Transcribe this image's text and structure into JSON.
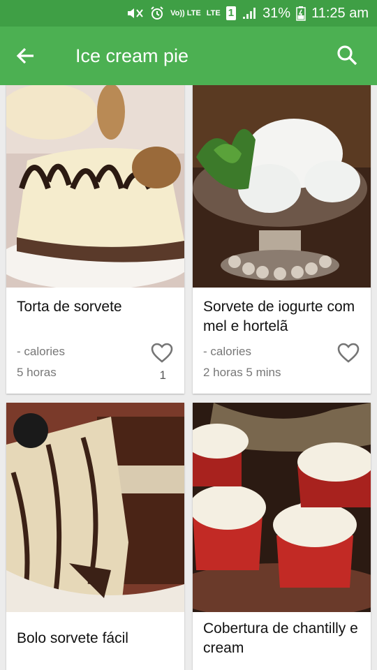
{
  "status_bar": {
    "volte_label": "Vo)) LTE",
    "lte_label": "LTE",
    "sim_number": "1",
    "battery": "31%",
    "time": "11:25 am"
  },
  "app_bar": {
    "title": "Ice cream pie",
    "back_icon": "arrow-back-icon",
    "search_icon": "search-icon",
    "background_color": "#4cb052",
    "status_color": "#3f9f45"
  },
  "recipes": [
    {
      "title": "Torta de sorvete",
      "calories": "- calories",
      "time": "5 horas",
      "likes": "1"
    },
    {
      "title": "Sorvete de iogurte com mel e hortelã",
      "calories": "- calories",
      "time": "2 horas 5 mins",
      "likes": ""
    },
    {
      "title": "Bolo sorvete fácil",
      "calories": "",
      "time": "",
      "likes": ""
    },
    {
      "title": "Cobertura de chantilly e cream",
      "calories": "",
      "time": "",
      "likes": ""
    }
  ]
}
